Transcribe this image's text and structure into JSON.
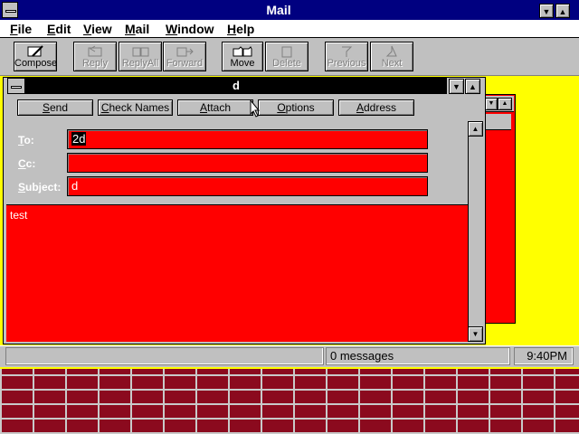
{
  "app": {
    "title": "Mail"
  },
  "menubar": {
    "items": [
      "File",
      "Edit",
      "View",
      "Mail",
      "Window",
      "Help"
    ]
  },
  "toolbar": {
    "buttons": [
      {
        "label": "Compose",
        "enabled": true,
        "icon": "compose-icon"
      },
      {
        "label": "Reply",
        "enabled": false,
        "icon": "reply-icon"
      },
      {
        "label": "ReplyAll",
        "enabled": false,
        "icon": "reply-all-icon"
      },
      {
        "label": "Forward",
        "enabled": false,
        "icon": "forward-icon"
      },
      {
        "label": "Move",
        "enabled": true,
        "icon": "move-folder-icon"
      },
      {
        "label": "Delete",
        "enabled": false,
        "icon": "delete-icon"
      },
      {
        "label": "Previous",
        "enabled": false,
        "icon": "previous-icon"
      },
      {
        "label": "Next",
        "enabled": false,
        "icon": "next-icon"
      }
    ]
  },
  "compose": {
    "title": "d",
    "buttons": [
      "Send",
      "Check Names",
      "Attach",
      "Options",
      "Address"
    ],
    "fields": {
      "to_label": "To:",
      "to_value": "2d",
      "cc_label": "Cc:",
      "cc_value": "",
      "subject_label": "Subject:",
      "subject_value": "d"
    },
    "body": "test"
  },
  "status": {
    "messages": "0 messages",
    "time": "9:40PM"
  },
  "colors": {
    "desktop": "#8b0a1e",
    "window_bg": "#ffff00",
    "field_bg": "#ff0000",
    "titlebar": "#000080"
  }
}
